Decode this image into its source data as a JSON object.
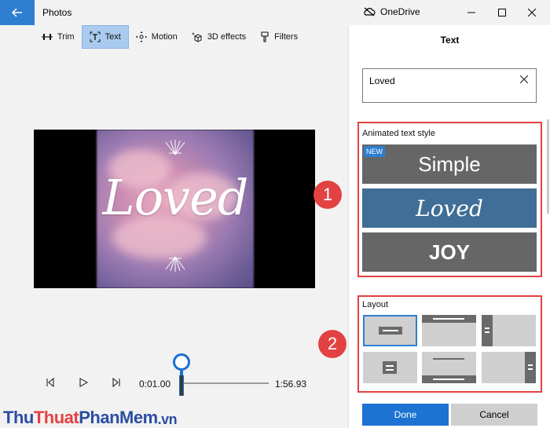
{
  "window": {
    "app_title": "Photos",
    "onedrive_label": "OneDrive"
  },
  "toolbar": {
    "tools": [
      {
        "label": "Trim",
        "icon": "trim-icon"
      },
      {
        "label": "Text",
        "icon": "text-icon",
        "active": true
      },
      {
        "label": "Motion",
        "icon": "motion-icon"
      },
      {
        "label": "3D effects",
        "icon": "3d-effects-icon"
      },
      {
        "label": "Filters",
        "icon": "filters-icon"
      }
    ]
  },
  "preview": {
    "overlay_text": "Loved"
  },
  "playback": {
    "current_time": "0:01.00",
    "end_time": "1:56.93"
  },
  "watermark": {
    "part1": "Thu",
    "part2": "Thuat",
    "part3": "PhanMem",
    "part4": ".vn"
  },
  "badges": [
    "1",
    "2"
  ],
  "panel": {
    "title": "Text",
    "text_value": "Loved",
    "animated_section_label": "Animated text style",
    "styles": [
      {
        "label": "Simple",
        "tag": "NEW"
      },
      {
        "label": "Loved",
        "selected": true
      },
      {
        "label": "JOY"
      }
    ],
    "layout_section_label": "Layout",
    "layouts_count_note": "",
    "done_label": "Done",
    "cancel_label": "Cancel"
  },
  "colors": {
    "accent": "#1c73d1",
    "highlight": "#e34242",
    "tile_gray": "#666666",
    "tile_selected": "#3f6e96"
  }
}
